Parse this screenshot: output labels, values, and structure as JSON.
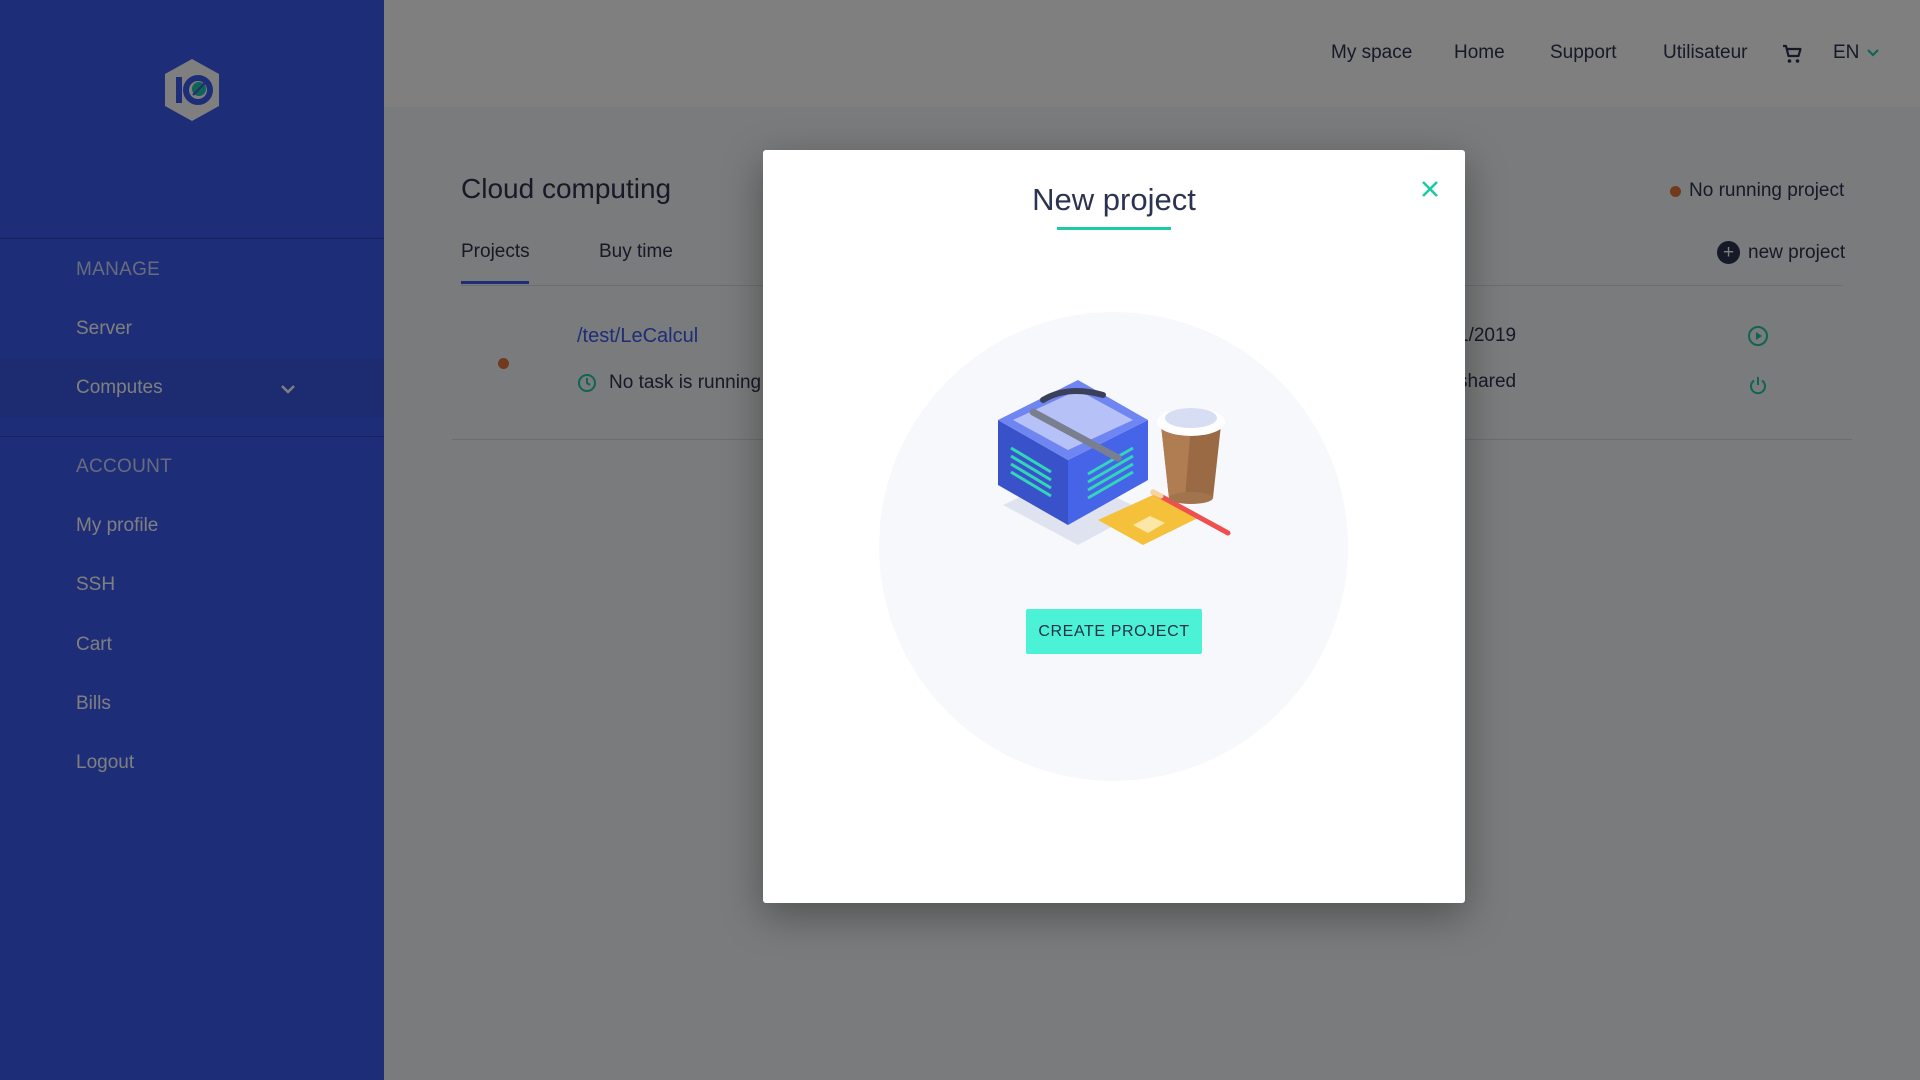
{
  "sidebar": {
    "logo": "io-hexagon-logo",
    "sections": [
      {
        "heading": "MANAGE",
        "items": [
          {
            "label": "Server"
          },
          {
            "label": "Computes",
            "active": true
          }
        ]
      },
      {
        "heading": "ACCOUNT",
        "items": [
          {
            "label": "My profile"
          },
          {
            "label": "SSH"
          },
          {
            "label": "Cart"
          },
          {
            "label": "Bills"
          },
          {
            "label": "Logout"
          }
        ]
      }
    ]
  },
  "topbar": {
    "nav": [
      {
        "label": "My space"
      },
      {
        "label": "Home"
      },
      {
        "label": "Support"
      },
      {
        "label": "Utilisateur"
      }
    ],
    "cart_icon": "shopping-cart-icon",
    "language": "EN"
  },
  "page": {
    "title": "Cloud computing",
    "status": "No running project",
    "tabs": [
      {
        "label": "Projects",
        "active": true
      },
      {
        "label": "Buy time"
      }
    ],
    "new_project_label": "new project",
    "projects": [
      {
        "path": "/test/LeCalcul",
        "task_status": "No task is running",
        "date_fragment": "1/2019",
        "shared_fragment": "shared"
      }
    ]
  },
  "modal": {
    "title": "New project",
    "button_label": "CREATE PROJECT"
  },
  "colors": {
    "sidebar": "#3d5bf0",
    "accent_teal": "#1ec9a6",
    "button": "#4cf2d6",
    "text_dark": "#2c3350",
    "status_orange": "#e5743b"
  }
}
